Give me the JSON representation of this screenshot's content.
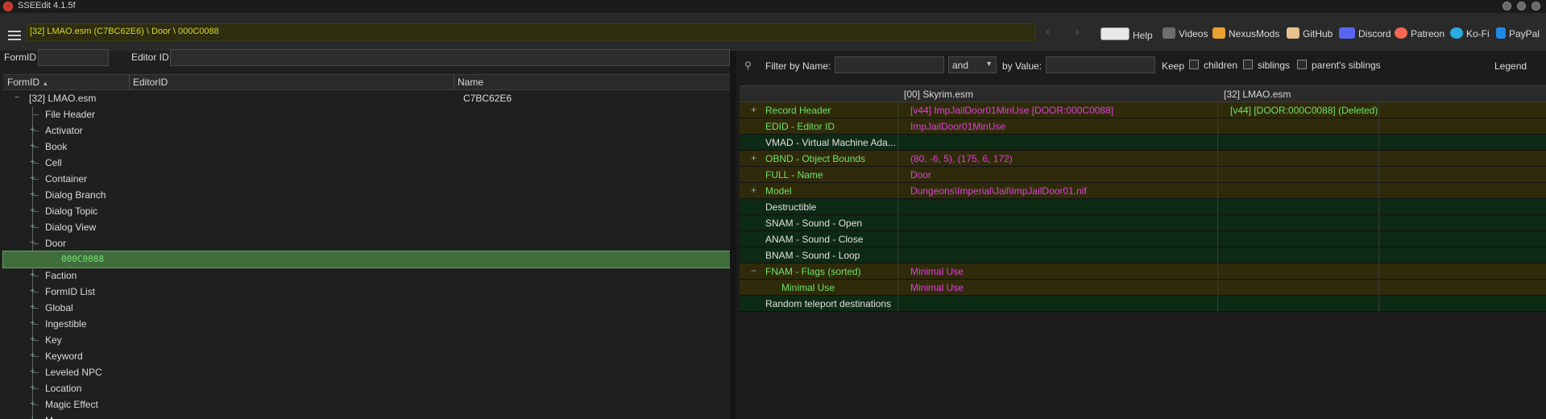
{
  "window": {
    "title": "SSEEdit 4.1.5f"
  },
  "toolbar": {
    "path": "[32] LMAO.esm (C7BC62E6) \\ Door \\ 000C0088",
    "back_arrow": "‹",
    "forward_arrow": "›",
    "links": [
      {
        "label": "Help",
        "icon": "book-icon",
        "color": "#d0d0d0"
      },
      {
        "label": "Videos",
        "icon": "gp-icon",
        "color": "#8a8a8a"
      },
      {
        "label": "NexusMods",
        "icon": "nexusmods-icon",
        "color": "#e8a030"
      },
      {
        "label": "GitHub",
        "icon": "github-icon",
        "color": "#e8c090"
      },
      {
        "label": "Discord",
        "icon": "discord-icon",
        "color": "#5865f2"
      },
      {
        "label": "Patreon",
        "icon": "patreon-icon",
        "color": "#f96854"
      },
      {
        "label": "Ko-Fi",
        "icon": "kofi-icon",
        "color": "#29abe0"
      },
      {
        "label": "PayPal",
        "icon": "paypal-icon",
        "color": "#1e88e5"
      }
    ]
  },
  "left": {
    "formid_label": "FormID",
    "editorid_label": "Editor ID",
    "formid_value": "",
    "editorid_value": "",
    "columns": [
      "FormID",
      "EditorID",
      "Name"
    ],
    "sort_indicator": "▲",
    "root": {
      "label": "[32] LMAO.esm",
      "name": "C7BC62E6"
    },
    "items": [
      {
        "label": "File Header",
        "expandable": false
      },
      {
        "label": "Activator",
        "expandable": true
      },
      {
        "label": "Book",
        "expandable": true
      },
      {
        "label": "Cell",
        "expandable": true
      },
      {
        "label": "Container",
        "expandable": true
      },
      {
        "label": "Dialog Branch",
        "expandable": true
      },
      {
        "label": "Dialog Topic",
        "expandable": true
      },
      {
        "label": "Dialog View",
        "expandable": true
      },
      {
        "label": "Door",
        "expandable": true,
        "expanded": true
      },
      {
        "label": "000C0088",
        "child": true,
        "selected": true
      },
      {
        "label": "Faction",
        "expandable": true
      },
      {
        "label": "FormID List",
        "expandable": true
      },
      {
        "label": "Global",
        "expandable": true
      },
      {
        "label": "Ingestible",
        "expandable": true
      },
      {
        "label": "Key",
        "expandable": true
      },
      {
        "label": "Keyword",
        "expandable": true
      },
      {
        "label": "Leveled NPC",
        "expandable": true
      },
      {
        "label": "Location",
        "expandable": true
      },
      {
        "label": "Magic Effect",
        "expandable": true
      },
      {
        "label": "M",
        "expandable": true
      }
    ]
  },
  "right": {
    "pin_icon": "pin-icon",
    "filter_by_name_label": "Filter by Name:",
    "filter_name_value": "",
    "operator_value": "and",
    "by_value_label": "by Value:",
    "filter_value": "",
    "keep_label": "Keep",
    "keep_options": [
      "children",
      "siblings",
      "parent's siblings"
    ],
    "legend_label": "Legend",
    "columns": [
      "",
      "[00] Skyrim.esm",
      "[32] LMAO.esm"
    ],
    "rows": [
      {
        "name": "Record Header",
        "v1": "[v44] ImpJailDoor01MinUse [DOOR:000C0088]",
        "v2": "[v44] [DOOR:000C0088] (Deleted)",
        "style": "yl",
        "plus": "+"
      },
      {
        "name": "EDID - Editor ID",
        "v1": "ImpJailDoor01MinUse",
        "v2": "",
        "style": "yl",
        "plus": ""
      },
      {
        "name": "VMAD - Virtual Machine Ada...",
        "v1": "",
        "v2": "",
        "style": "gr",
        "plus": ""
      },
      {
        "name": "OBND - Object Bounds",
        "v1": "(80, -6, 5), (175, 6, 172)",
        "v2": "",
        "style": "yl",
        "plus": "+"
      },
      {
        "name": "FULL - Name",
        "v1": "Door",
        "v2": "",
        "style": "yl",
        "plus": ""
      },
      {
        "name": "Model",
        "v1": "Dungeons\\Imperial\\Jail\\ImpJailDoor01.nif",
        "v2": "",
        "style": "yl",
        "plus": "+"
      },
      {
        "name": "Destructible",
        "v1": "",
        "v2": "",
        "style": "gr",
        "plus": ""
      },
      {
        "name": "SNAM - Sound - Open",
        "v1": "",
        "v2": "",
        "style": "gr",
        "plus": ""
      },
      {
        "name": "ANAM - Sound - Close",
        "v1": "",
        "v2": "",
        "style": "gr",
        "plus": ""
      },
      {
        "name": "BNAM - Sound - Loop",
        "v1": "",
        "v2": "",
        "style": "gr",
        "plus": ""
      },
      {
        "name": "FNAM - Flags (sorted)",
        "v1": "Minimal Use",
        "v2": "",
        "style": "yl",
        "plus": "−"
      },
      {
        "name": "Minimal Use",
        "v1": "Minimal Use",
        "v2": "",
        "style": "yl",
        "plus": "",
        "indent": true
      },
      {
        "name": "Random teleport destinations",
        "v1": "",
        "v2": "",
        "style": "gr",
        "plus": ""
      }
    ]
  }
}
